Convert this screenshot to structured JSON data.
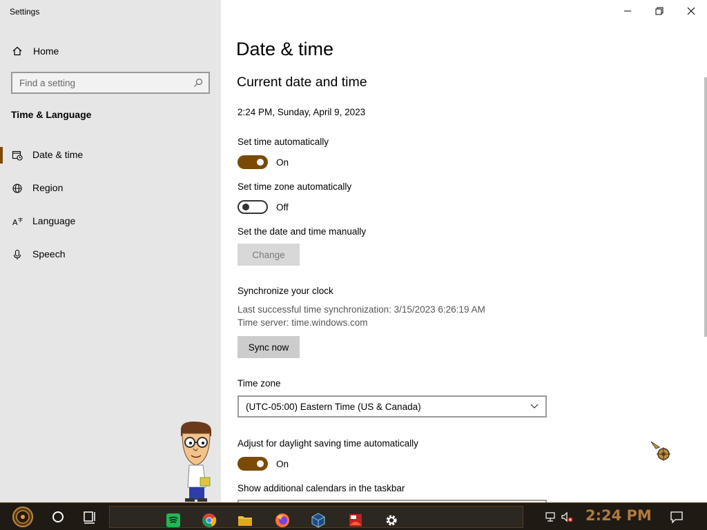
{
  "window": {
    "app_title": "Settings",
    "minimize_icon": "minimize-icon",
    "restore_icon": "restore-icon",
    "close_icon": "close-icon"
  },
  "sidebar": {
    "home_label": "Home",
    "home_icon": "home-icon",
    "search_placeholder": "Find a setting",
    "search_icon": "search-icon",
    "section_title": "Time & Language",
    "items": [
      {
        "label": "Date & time",
        "icon": "calendar-clock-icon",
        "selected": true
      },
      {
        "label": "Region",
        "icon": "globe-icon",
        "selected": false
      },
      {
        "label": "Language",
        "icon": "language-icon",
        "selected": false
      },
      {
        "label": "Speech",
        "icon": "microphone-icon",
        "selected": false
      }
    ]
  },
  "main": {
    "page_title": "Date & time",
    "subtitle": "Current date and time",
    "current_datetime": "2:24 PM, Sunday, April 9, 2023",
    "set_time_auto": {
      "label": "Set time automatically",
      "state": "On",
      "on": true
    },
    "set_tz_auto": {
      "label": "Set time zone automatically",
      "state": "Off",
      "on": false
    },
    "manual": {
      "label": "Set the date and time manually",
      "button": "Change"
    },
    "sync": {
      "heading": "Synchronize your clock",
      "last_sync": "Last successful time synchronization: 3/15/2023 6:26:19 AM",
      "server": "Time server: time.windows.com",
      "button": "Sync now"
    },
    "timezone": {
      "label": "Time zone",
      "value": "(UTC-05:00) Eastern Time (US & Canada)"
    },
    "dst": {
      "label": "Adjust for daylight saving time automatically",
      "state": "On",
      "on": true
    },
    "calendars_label": "Show additional calendars in the taskbar"
  },
  "taskbar": {
    "clock": "2:24 PM",
    "pinned": [
      "spotify-icon",
      "chrome-icon",
      "file-explorer-icon",
      "firefox-icon",
      "virtualbox-icon",
      "app-icon",
      "settings-gear-icon"
    ]
  },
  "colors": {
    "accent": "#7a4a06",
    "sidebar_bg": "#e6e6e6",
    "taskbar_bg": "#201a14",
    "clock_color": "#b07a3c"
  }
}
